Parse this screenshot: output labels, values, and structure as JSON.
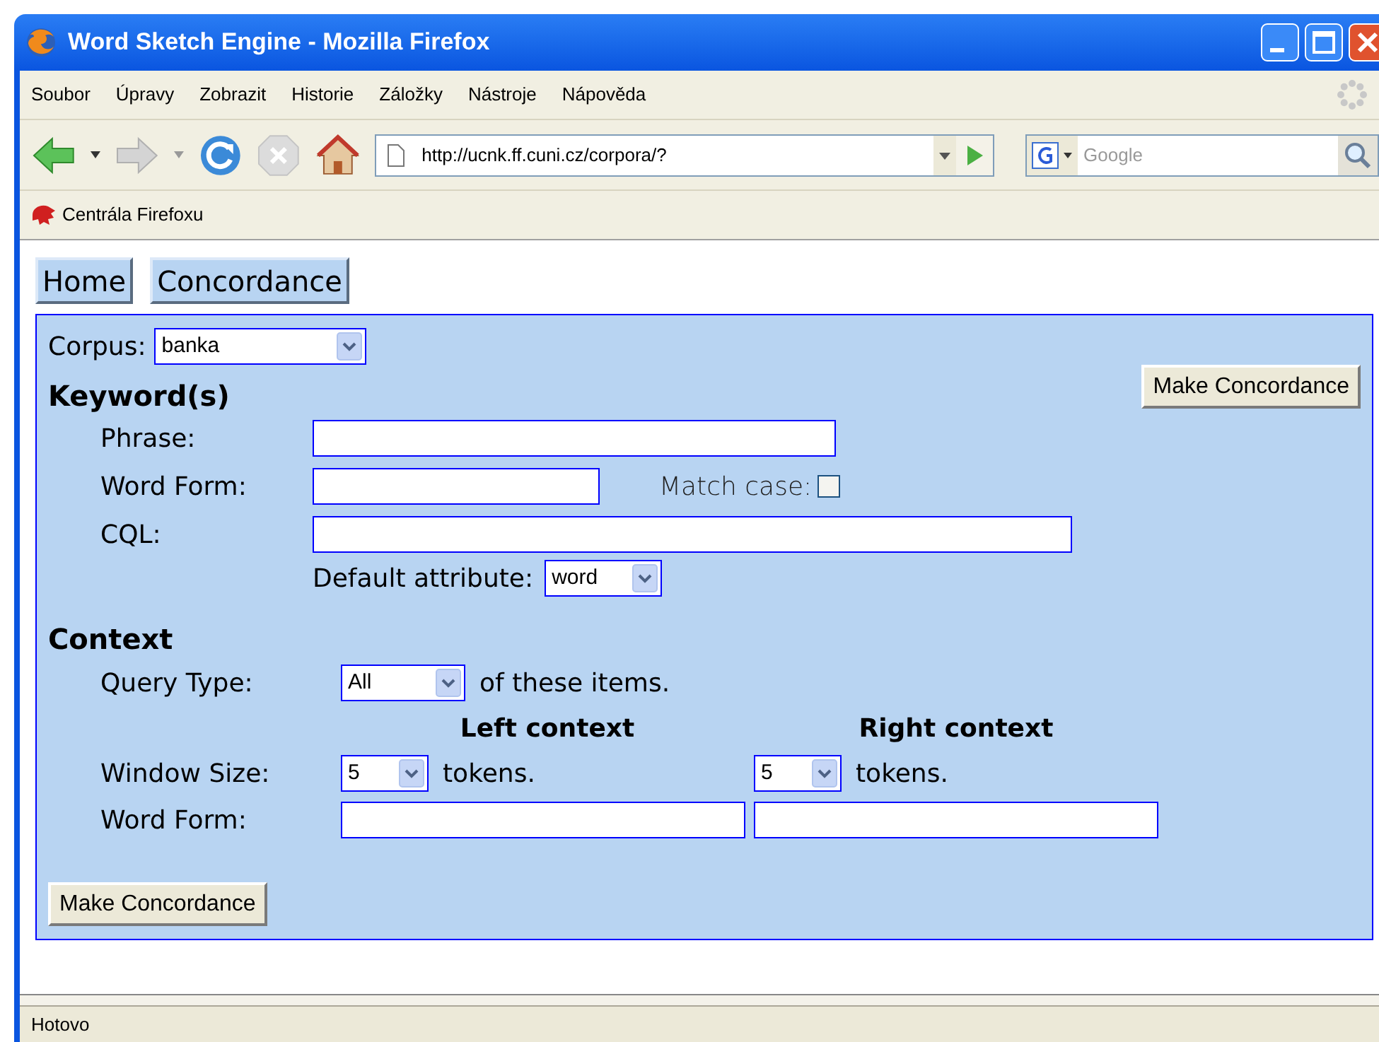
{
  "window": {
    "title": "Word Sketch Engine - Mozilla Firefox"
  },
  "menu": [
    "Soubor",
    "Úpravy",
    "Zobrazit",
    "Historie",
    "Záložky",
    "Nástroje",
    "Nápověda"
  ],
  "address_bar": {
    "value": "http://ucnk.ff.cuni.cz/corpora/?"
  },
  "search_bar": {
    "placeholder": "Google"
  },
  "bookmarks": [
    "Centrála Firefoxu"
  ],
  "nav_buttons": [
    "Home",
    "Concordance"
  ],
  "form": {
    "corpus_label": "Corpus:",
    "corpus_value": "banka",
    "top_button": "Make Concordance",
    "keyword_heading": "Keyword(s)",
    "phrase_label": "Phrase:",
    "word_form_label": "Word Form:",
    "match_case_label": "Match case:",
    "match_case_checked": false,
    "cql_label": "CQL:",
    "default_attribute_label": "Default attribute:",
    "default_attribute_value": "word",
    "context_heading": "Context",
    "query_type_label": "Query Type:",
    "query_type_value": "All",
    "query_type_suffix": "of these items.",
    "left_context": "Left context",
    "right_context": "Right context",
    "window_size_label": "Window Size:",
    "left_size": "5",
    "left_tokens": "tokens.",
    "right_size": "5",
    "right_tokens": "tokens.",
    "context_word_form_label": "Word Form:",
    "bottom_button": "Make Concordance"
  },
  "status_bar": "Hotovo"
}
